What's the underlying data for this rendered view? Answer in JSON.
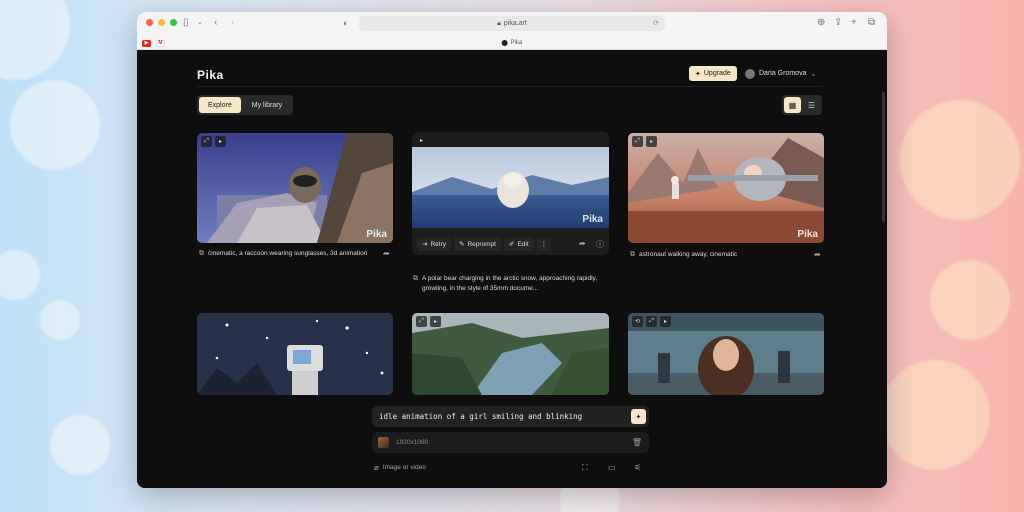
{
  "browser": {
    "url": "pika.art",
    "tab_title": "Pika",
    "lock_icon": "lock-icon",
    "translate_icon": "translate-icon"
  },
  "colors": {
    "accent": "#f6e7c6",
    "page_bg": "#0e0e0e",
    "card_bg": "#1d1d1d"
  },
  "header": {
    "logo": "Pika",
    "upgrade_label": "Upgrade",
    "user_name": "Daria Gromova"
  },
  "tabs": [
    {
      "label": "Explore",
      "active": true
    },
    {
      "label": "My library",
      "active": false
    }
  ],
  "gallery": {
    "watermark": "Pika",
    "cards": [
      {
        "caption": "cinematic, a raccoon wearing sunglasses, 3d animation"
      },
      {
        "caption": "A polar bear charging in the arctic snow, approaching rapidly, growling, in the style of 35mm docume...",
        "actions": {
          "retry": "Retry",
          "reprompt": "Reprompt",
          "edit": "Edit"
        }
      },
      {
        "caption": "astronaut walking away, cinematic"
      }
    ]
  },
  "composer": {
    "prompt": "idle animation of a girl smiling and blinking",
    "asset_resolution": "1920x1080",
    "attach_label": "Image or video"
  }
}
